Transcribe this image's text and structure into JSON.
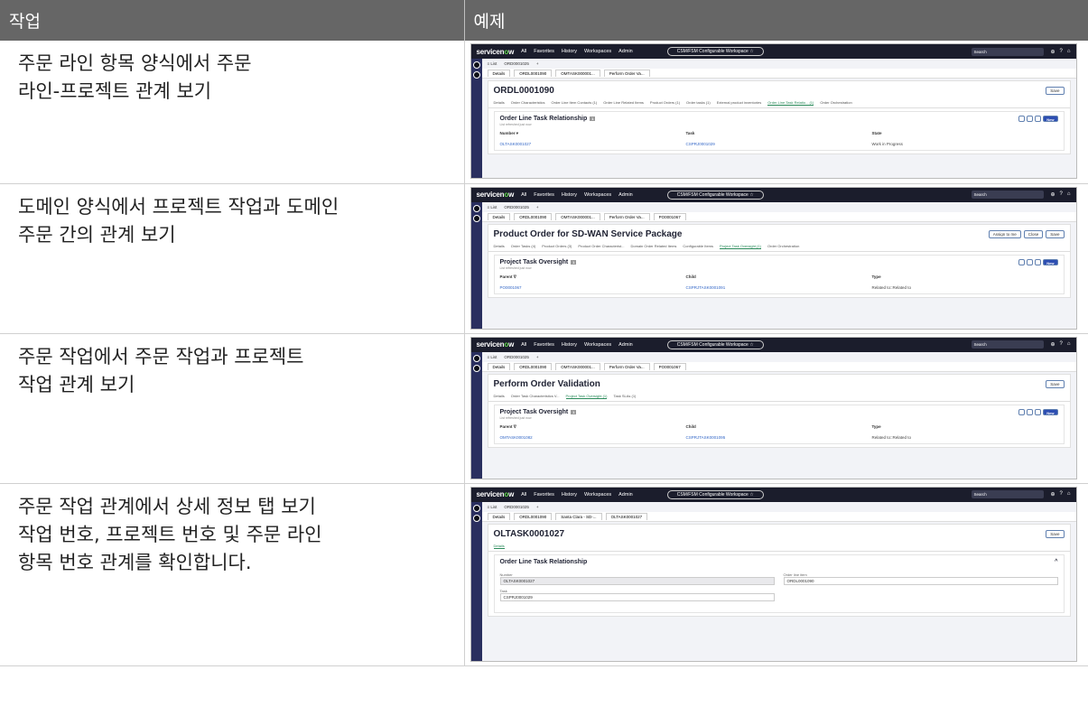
{
  "header": {
    "task": "작업",
    "example": "예제"
  },
  "rows": [
    {
      "task": "주문 라인 항목 양식에서 주문\n라인-프로젝트 관계 보기",
      "shot": {
        "nav": [
          "All",
          "Favorites",
          "History",
          "Workspaces",
          "Admin"
        ],
        "workspace": "CSM/FSM Configurable Workspace ☆",
        "search": "Search",
        "list_tab": "≡ List",
        "list_tab2": "ORD0001025",
        "tabs": [
          "Details",
          "ORDL0001090",
          "OMTASK000001...",
          "Perform Order Va..."
        ],
        "title": "ORDL0001090",
        "buttons": [
          "Save"
        ],
        "rtabs": [
          "Details",
          "Order Characteristics",
          "Order Line Item Contacts (1)",
          "Order Line Related Items",
          "Product Orders (1)",
          "Order tasks (1)",
          "External product inventories",
          "Order Line Task Relatio... (1)",
          "Order Orchestration"
        ],
        "active_rtab": 7,
        "rel_title": "Order Line Task Relationship",
        "rel_count": "1",
        "rel_sub": "List refreshed just now",
        "cols": [
          "Number ▾",
          "Task",
          "State"
        ],
        "vals": [
          "OLTASK0001027",
          "CSPRJ0001029",
          "Work in Progress"
        ]
      }
    },
    {
      "task": "도메인 양식에서 프로젝트 작업과 도메인\n주문 간의 관계 보기",
      "shot": {
        "nav": [
          "All",
          "Favorites",
          "History",
          "Workspaces",
          "Admin"
        ],
        "workspace": "CSM/FSM Configurable Workspace ☆",
        "search": "Search",
        "list_tab": "≡ List",
        "list_tab2": "ORD0001025",
        "tabs": [
          "Details",
          "ORDL0001090",
          "OMTASK000001...",
          "Perform Order Va...",
          "PO0001067"
        ],
        "title": "Product Order for SD-WAN Service Package",
        "buttons": [
          "Assign to me",
          "Close",
          "Save"
        ],
        "rtabs": [
          "Details",
          "Order Tasks (4)",
          "Product Orders (3)",
          "Product Order Characterist...",
          "Domain Order Related Items",
          "Configurable Items",
          "Project Task Oversight (1)",
          "Order Orchestration"
        ],
        "active_rtab": 6,
        "rel_title": "Project Task Oversight",
        "rel_count": "1",
        "rel_sub": "List refreshed just now",
        "cols": [
          "Parent ∇",
          "Child",
          "Type"
        ],
        "vals": [
          "PO0001067",
          "CSPRJTASK0001091",
          "Related to::Related to"
        ]
      }
    },
    {
      "task": "주문 작업에서 주문 작업과 프로젝트\n작업 관계 보기",
      "shot": {
        "nav": [
          "All",
          "Favorites",
          "History",
          "Workspaces",
          "Admin"
        ],
        "workspace": "CSM/FSM Configurable Workspace ☆",
        "search": "Search",
        "list_tab": "≡ List",
        "list_tab2": "ORD0001025",
        "tabs": [
          "Details",
          "ORDL0001090",
          "OMTASK000001...",
          "Perform Order Va...",
          "PO0001067"
        ],
        "title": "Perform Order Validation",
        "buttons": [
          "Save"
        ],
        "rtabs": [
          "Details",
          "Order Task Characteristics V...",
          "Project Task Oversight (1)",
          "Task SLAs (1)"
        ],
        "active_rtab": 2,
        "rel_title": "Project Task Oversight",
        "rel_count": "1",
        "rel_sub": "List refreshed just now",
        "cols": [
          "Parent ∇",
          "Child",
          "Type"
        ],
        "vals": [
          "OMTASK0001082",
          "CSPRJTASK0001095",
          "Related to::Related to"
        ]
      }
    },
    {
      "task": "주문 작업 관계에서 상세 정보 탭 보기\n작업 번호, 프로젝트 번호 및 주문 라인\n항목 번호 관계를 확인합니다.",
      "shot": {
        "nav": [
          "All",
          "Favorites",
          "History",
          "Workspaces",
          "Admin"
        ],
        "workspace": "CSM/FSM Configurable Workspace ☆",
        "search": "Search",
        "list_tab": "≡ List",
        "list_tab2": "ORD0001025",
        "tabs": [
          "Details",
          "ORDL0001090",
          "Santa Clara - SD-...",
          "OLTASK0001027"
        ],
        "title": "OLTASK0001027",
        "buttons": [
          "Save"
        ],
        "detail_tab": "Details",
        "section": "Order Line Task Relationship",
        "fields": {
          "number_label": "Number",
          "number": "OLTASK0001027",
          "line_label": "Order line item",
          "line": "ORDL0001090",
          "task_label": "Task",
          "task": "CSPRJ0001029"
        }
      }
    }
  ]
}
